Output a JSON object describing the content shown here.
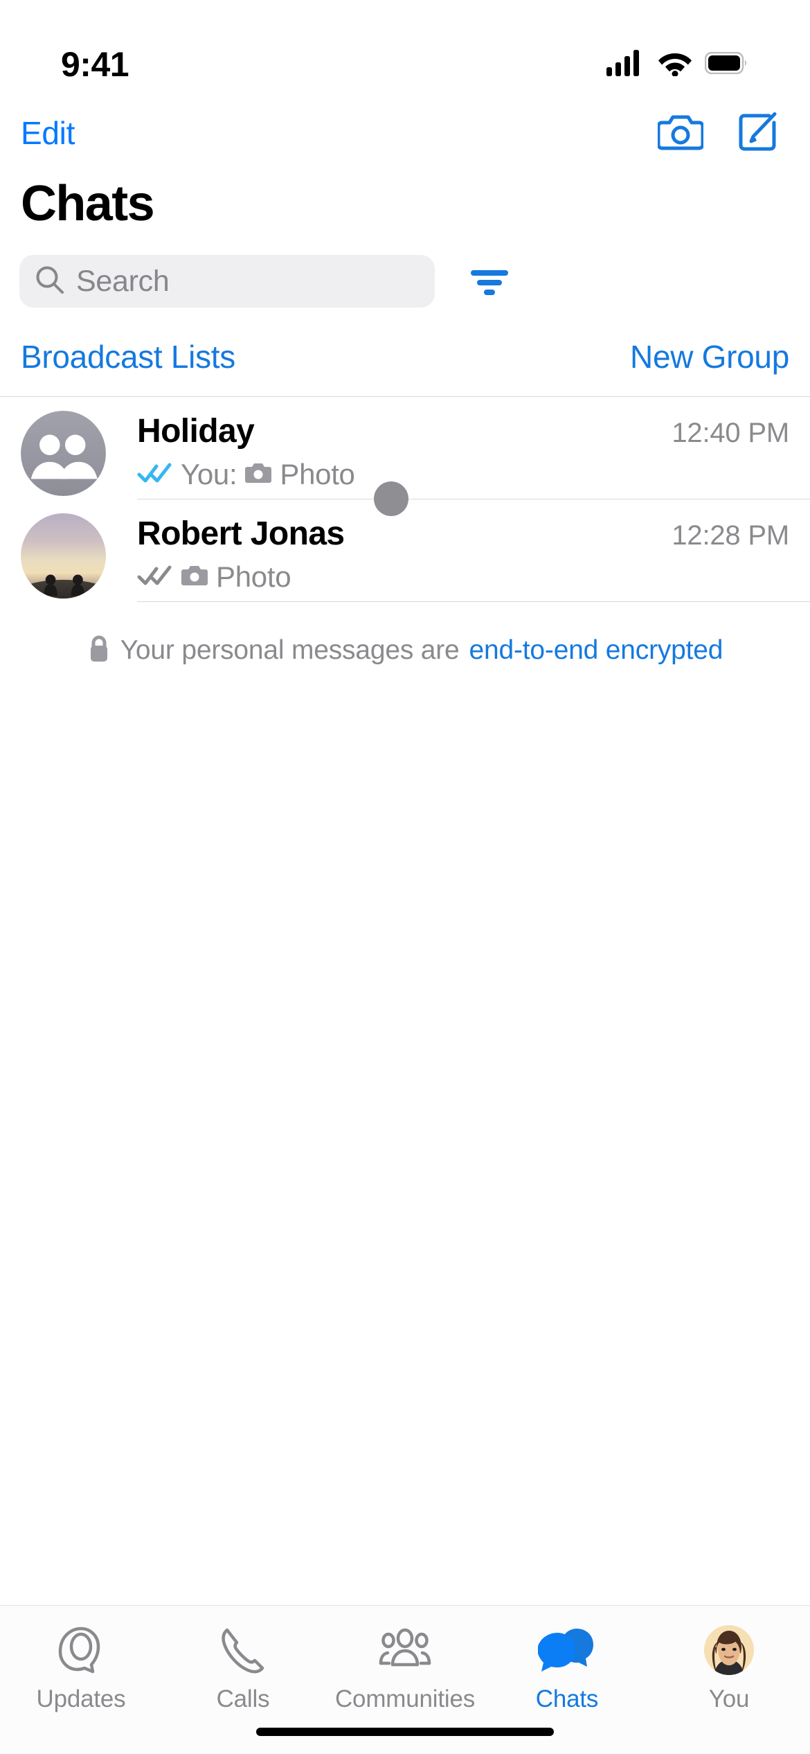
{
  "status_bar": {
    "time": "9:41",
    "icons": [
      "cellular-signal-icon",
      "wifi-icon",
      "battery-icon"
    ]
  },
  "nav_bar": {
    "edit_label": "Edit",
    "camera_icon": "camera-icon",
    "compose_icon": "compose-icon"
  },
  "header": {
    "title": "Chats"
  },
  "search": {
    "placeholder": "Search",
    "icon": "search-icon",
    "filter_icon": "filter-icon"
  },
  "actions": {
    "broadcast_label": "Broadcast Lists",
    "new_group_label": "New Group"
  },
  "chats": [
    {
      "name": "Holiday",
      "time": "12:40 PM",
      "prefix": "You:",
      "snippet": "Photo",
      "status_icon": "double-check-icon",
      "status_read": true,
      "attachment_icon": "camera-icon",
      "avatar_type": "group-placeholder-avatar"
    },
    {
      "name": "Robert Jonas",
      "time": "12:28 PM",
      "prefix": "",
      "snippet": "Photo",
      "status_icon": "double-check-icon",
      "status_read": false,
      "attachment_icon": "camera-icon",
      "avatar_type": "sunset-photo-avatar"
    }
  ],
  "encryption_notice": {
    "icon": "lock-icon",
    "text": "Your personal messages are",
    "link": "end-to-end encrypted"
  },
  "tab_bar": {
    "items": [
      {
        "label": "Updates",
        "icon": "updates-icon",
        "active": false
      },
      {
        "label": "Calls",
        "icon": "phone-icon",
        "active": false
      },
      {
        "label": "Communities",
        "icon": "communities-icon",
        "active": false
      },
      {
        "label": "Chats",
        "icon": "chats-bubbles-icon",
        "active": true
      },
      {
        "label": "You",
        "icon": "profile-avatar-icon",
        "active": false
      }
    ]
  },
  "colors": {
    "accent_blue": "#1579DE",
    "ios_blue": "#007AFF",
    "secondary_text": "#8A8A8E",
    "search_bg": "#EFEFF1",
    "read_check": "#34B7F1",
    "unread_check": "#8A8A8E",
    "separator": "#D8D8DC"
  }
}
